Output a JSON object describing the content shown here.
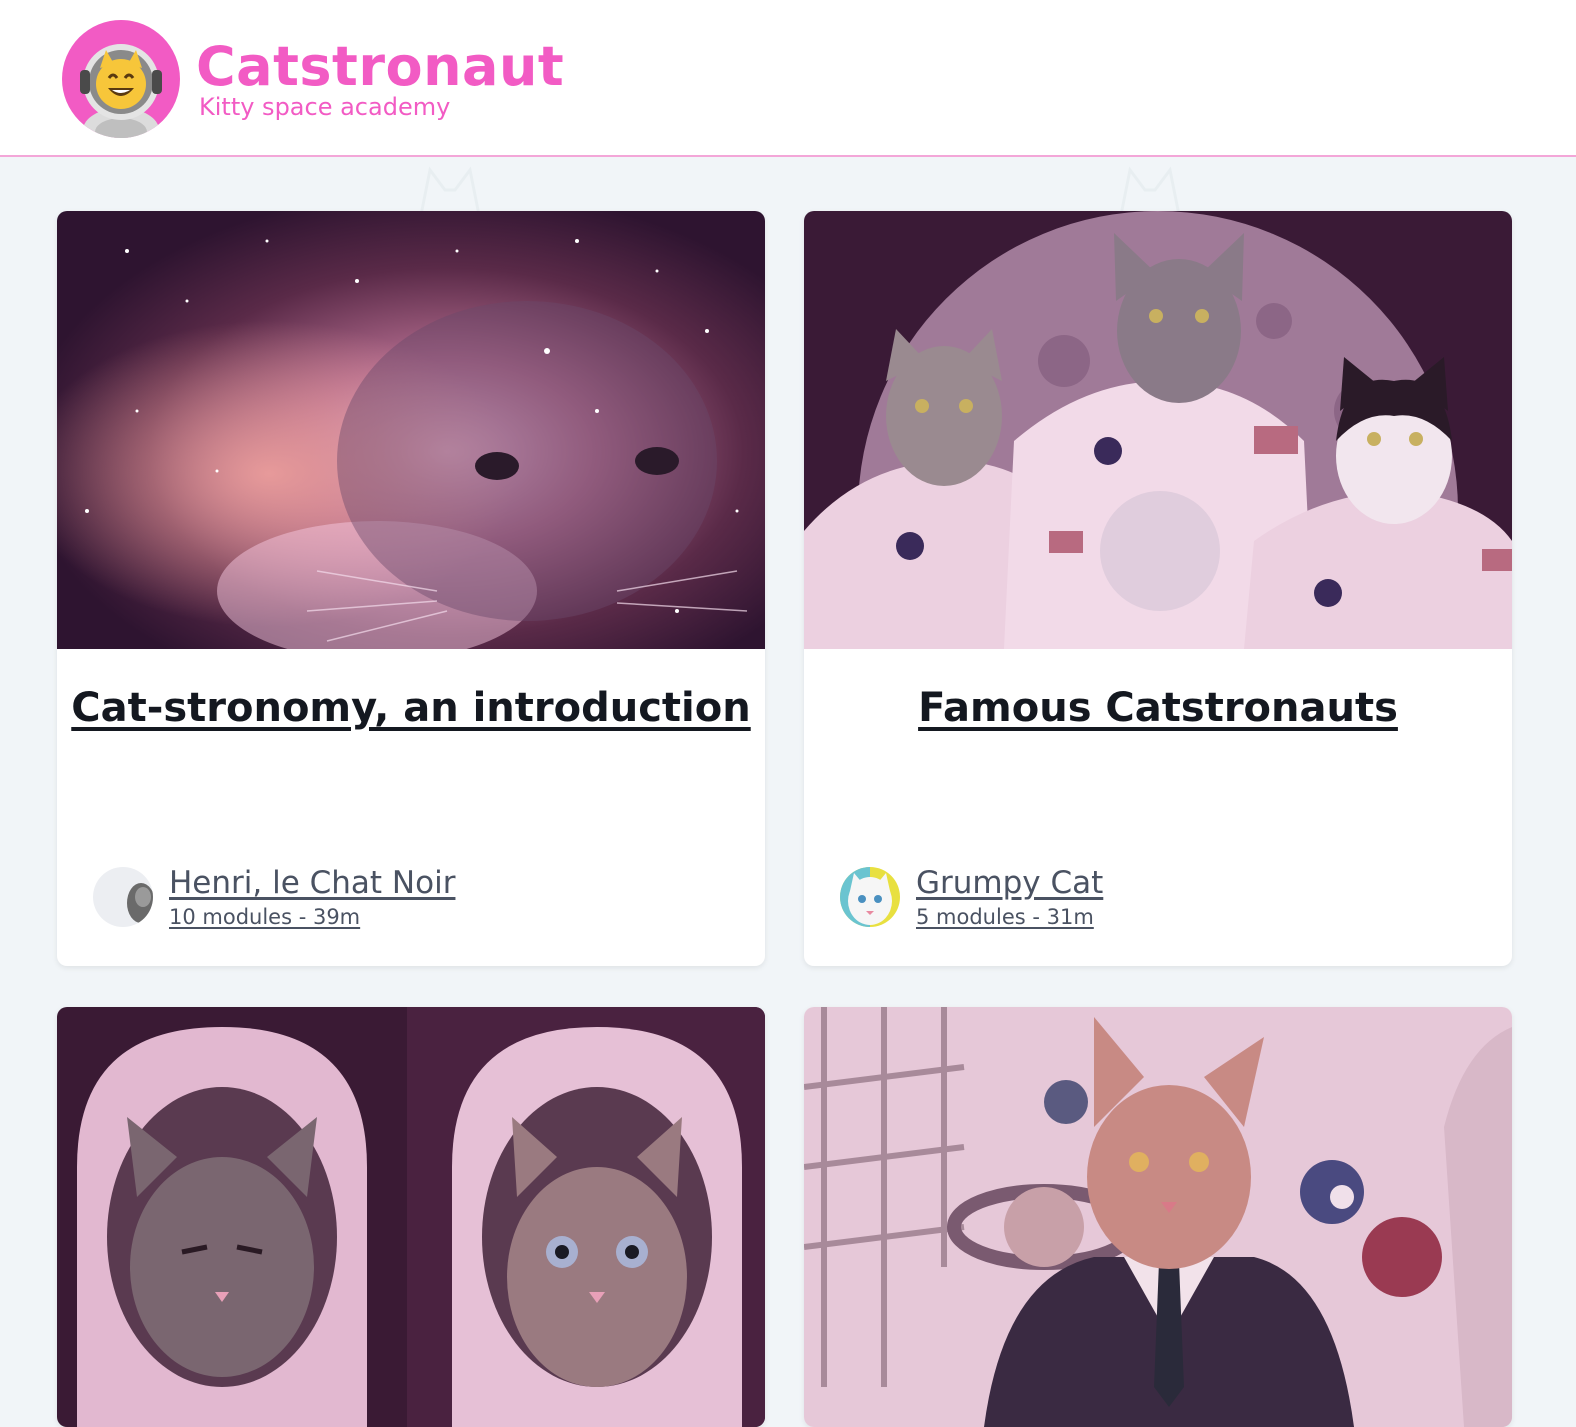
{
  "app": {
    "title": "Catstronaut",
    "tagline": "Kitty space academy"
  },
  "colors": {
    "brand": "#f25bc4",
    "page_bg": "#f1f5f8",
    "header_border": "#f3a6d8",
    "title_text": "#141820",
    "author_text": "#4a5262"
  },
  "logo": {
    "icon": "astronaut-cat-icon"
  },
  "tracks": [
    {
      "title": "Cat-stronomy, an introduction",
      "image": "space-nebula-cat-image",
      "author": "Henri, le Chat Noir",
      "meta": "10 modules - 39m"
    },
    {
      "title": "Famous Catstronauts",
      "image": "astronaut-cats-moon-image",
      "author": "Grumpy Cat",
      "meta": "5 modules - 31m"
    },
    {
      "image": "helmet-cats-image"
    },
    {
      "image": "suit-cat-planets-image"
    }
  ]
}
